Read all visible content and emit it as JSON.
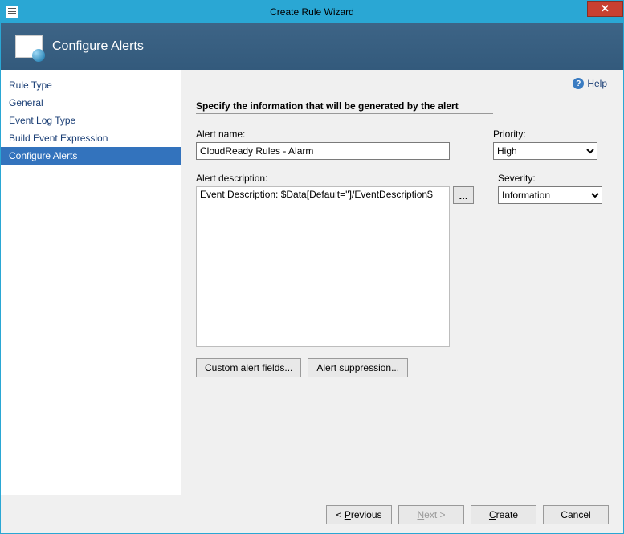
{
  "window": {
    "title": "Create Rule Wizard"
  },
  "header": {
    "page_title": "Configure Alerts"
  },
  "sidebar": {
    "items": [
      {
        "label": "Rule Type",
        "selected": false
      },
      {
        "label": "General",
        "selected": false
      },
      {
        "label": "Event Log Type",
        "selected": false
      },
      {
        "label": "Build Event Expression",
        "selected": false
      },
      {
        "label": "Configure Alerts",
        "selected": true
      }
    ]
  },
  "help": {
    "label": "Help"
  },
  "main": {
    "section_title": "Specify the information that will be generated by the alert",
    "alert_name_label": "Alert name:",
    "alert_name_value": "CloudReady Rules - Alarm",
    "priority_label": "Priority:",
    "priority_value": "High",
    "priority_options": [
      "High"
    ],
    "alert_description_label": "Alert description:",
    "alert_description_value": "Event Description: $Data[Default='']/EventDescription$",
    "severity_label": "Severity:",
    "severity_value": "Information",
    "severity_options": [
      "Information"
    ],
    "ellipsis_label": "...",
    "custom_fields_btn": "Custom alert fields...",
    "suppression_btn": "Alert suppression..."
  },
  "footer": {
    "previous_pre": "< ",
    "previous_mn": "P",
    "previous_post": "revious",
    "next_mn": "N",
    "next_post": "ext >",
    "create_pre": "",
    "create_mn": "C",
    "create_post": "reate",
    "cancel": "Cancel"
  }
}
